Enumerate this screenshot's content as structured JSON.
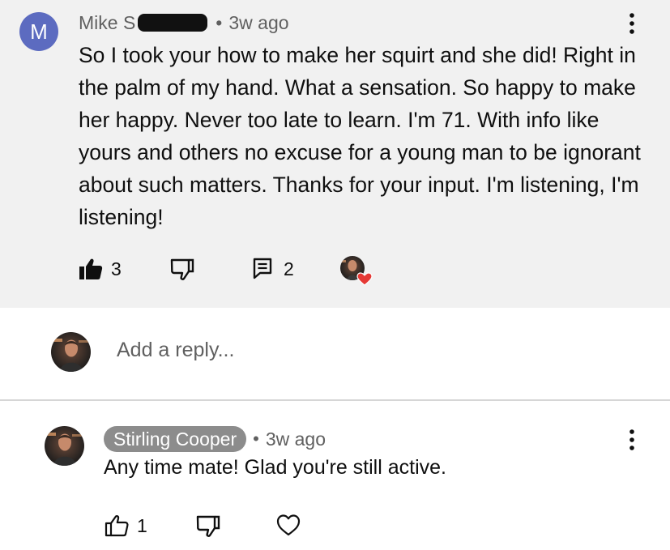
{
  "comment": {
    "avatar_letter": "M",
    "author": "Mike S",
    "separator": "•",
    "time": "3w ago",
    "text": "So I took your how to make her squirt and she did! Right in the palm of my hand. What a sensation.  So happy to make her happy.  Never too late to learn.  I'm 71. With info like yours and others no excuse for a young man to be ignorant about such matters.  Thanks for your input. I'm listening,  I'm listening!",
    "like_count": "3",
    "reply_count": "2",
    "icons": {
      "like": "thumbs-up-filled-icon",
      "dislike": "thumbs-down-icon",
      "replies": "comment-icon",
      "creator_heart": "creator-heart-icon",
      "menu": "more-vertical-icon"
    },
    "heart_color": "#e53935"
  },
  "reply_box": {
    "placeholder": "Add a reply..."
  },
  "reply": {
    "author": "Stirling Cooper",
    "separator": "•",
    "time": "3w ago",
    "text": "Any time mate! Glad you're still active.",
    "like_count": "1",
    "icons": {
      "like": "thumbs-up-outline-icon",
      "dislike": "thumbs-down-icon",
      "heart": "heart-outline-icon",
      "menu": "more-vertical-icon"
    },
    "author_chip_color": "#8c8c8c"
  }
}
